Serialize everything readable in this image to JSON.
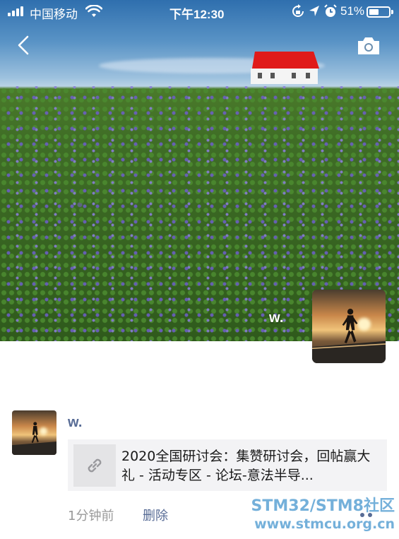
{
  "status_bar": {
    "carrier": "中国移动",
    "time": "下午12:30",
    "battery_percent": "51%",
    "battery_level": 0.51,
    "icons": [
      "signal-icon",
      "wifi-icon",
      "rotation-lock-icon",
      "location-icon",
      "alarm-icon",
      "battery-icon"
    ]
  },
  "header": {
    "back_icon": "chevron-left-icon",
    "camera_icon": "camera-icon"
  },
  "profile": {
    "name": "w."
  },
  "post": {
    "author": "w.",
    "link": {
      "icon": "link-icon",
      "title": "2020全国研讨会：集赞研讨会，回帖赢大礼 - 活动专区 - 论坛-意法半导..."
    },
    "time": "1分钟前",
    "delete_label": "删除",
    "more_icon": "more-dots-icon"
  },
  "watermark": {
    "line1": "STM32/STM8社区",
    "line2": "www.stmcu.org.cn"
  },
  "colors": {
    "link_blue": "#576b95",
    "card_bg": "#f3f3f5",
    "meta_gray": "#9a9a9a"
  }
}
